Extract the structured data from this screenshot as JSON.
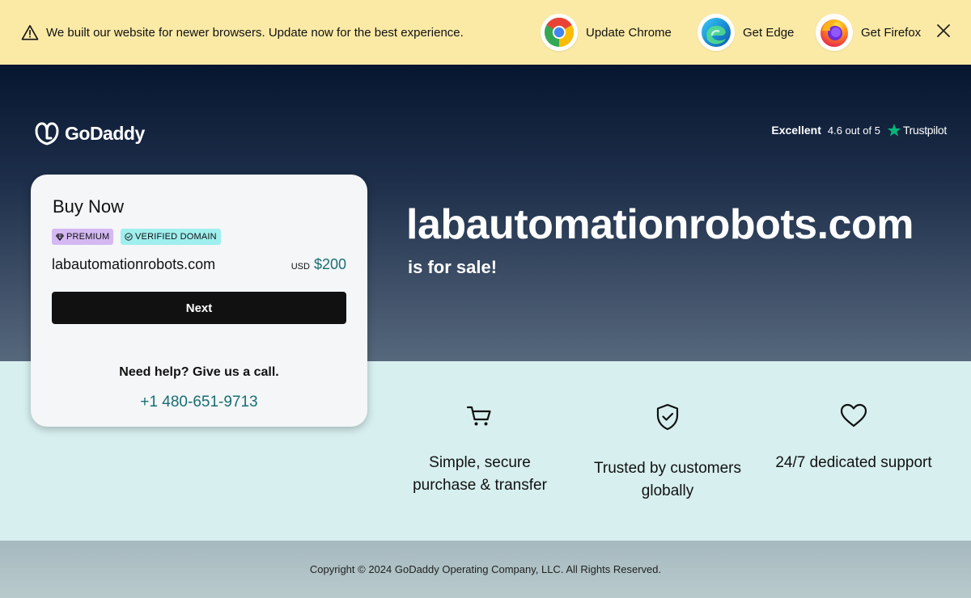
{
  "banner": {
    "message": "We built our website for newer browsers. Update now for the best experience.",
    "browsers": [
      {
        "label": "Update Chrome",
        "icon": "chrome-icon"
      },
      {
        "label": "Get Edge",
        "icon": "edge-icon"
      },
      {
        "label": "Get Firefox",
        "icon": "firefox-icon"
      }
    ]
  },
  "header": {
    "logo_text": "GoDaddy",
    "rating": {
      "label": "Excellent",
      "score": "4.6 out of 5",
      "brand": "Trustpilot"
    }
  },
  "hero": {
    "domain": "labautomationrobots.com",
    "subtitle": "is for sale!"
  },
  "card": {
    "title": "Buy Now",
    "badges": [
      "PREMIUM",
      "VERIFIED DOMAIN"
    ],
    "domain": "labautomationrobots.com",
    "currency": "USD",
    "price": "$200",
    "next_label": "Next",
    "help_text": "Need help? Give us a call.",
    "phone": "+1 480-651-9713"
  },
  "features": [
    {
      "icon": "cart-icon",
      "text": "Simple, secure purchase & transfer"
    },
    {
      "icon": "shield-check-icon",
      "text": "Trusted by customers globally"
    },
    {
      "icon": "heart-icon",
      "text": "24/7 dedicated support"
    }
  ],
  "footer": {
    "copyright": "Copyright © 2024 GoDaddy Operating Company, LLC. All Rights Reserved."
  },
  "colors": {
    "banner_bg": "#fbeaa6",
    "hero_top": "#07162f",
    "accent_teal": "#1a6e72",
    "badge_premium": "#d4b8f2",
    "badge_verified": "#9fefee",
    "trustpilot_green": "#00b67a"
  }
}
